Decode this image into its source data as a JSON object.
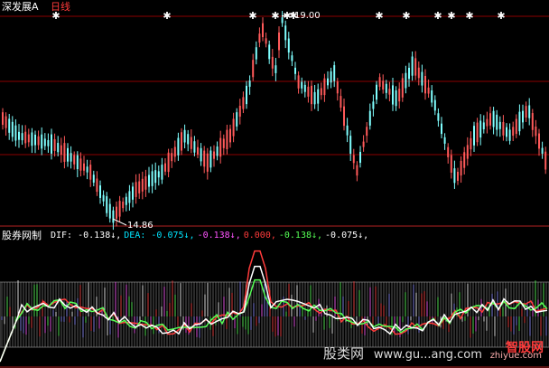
{
  "header": {
    "title": "深发展A",
    "period": "日线",
    "high_label": "19.00",
    "low_label": "14.86"
  },
  "indicator": {
    "name": "股券网制",
    "items": [
      {
        "label": "DIF:",
        "value": "-0.138↓,",
        "color": "#ffffff"
      },
      {
        "label": "DEA:",
        "value": "-0.075↓,",
        "color": "#00e5ff"
      },
      {
        "label": "",
        "value": "-0.138↓,",
        "color": "#ff55ff"
      },
      {
        "label": "",
        "value": "0.000,",
        "color": "#ff3b3b"
      },
      {
        "label": "",
        "value": "-0.138↓,",
        "color": "#55ff55"
      },
      {
        "label": "",
        "value": "-0.075↓,",
        "color": "#ffffff"
      }
    ]
  },
  "watermark": {
    "site1": "股类网",
    "site2": "www.gu...ang.com",
    "logo": "智股网",
    "logo_sub": "zhiyue.com"
  },
  "colors": {
    "bg": "#000000",
    "up": "#ff5a5a",
    "down": "#7fffff",
    "grid": "#8b0000",
    "dif": "#ffffff",
    "dea": "#55ff55",
    "band": "#a0a0a0"
  }
}
